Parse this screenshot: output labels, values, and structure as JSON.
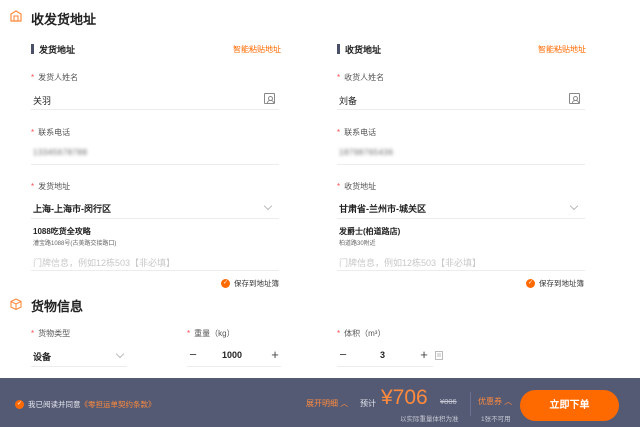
{
  "address_section": {
    "title": "收发货地址",
    "sender": {
      "heading": "发货地址",
      "smart_paste": "智能粘贴地址",
      "name_label": "发货人姓名",
      "name_value": "关羽",
      "phone_label": "联系电话",
      "phone_value": "13345678788",
      "address_label": "发货地址",
      "region_value": "上海-上海市-闵行区",
      "place_name": "1088吃货全攻略",
      "place_detail": "漕宝路1088号(古美路交接路口)",
      "door_placeholder": "门牌信息，例如12栋503【非必填】",
      "save_label": "保存到地址簿"
    },
    "receiver": {
      "heading": "收货地址",
      "smart_paste": "智能粘贴地址",
      "name_label": "收货人姓名",
      "name_value": "刘备",
      "phone_label": "联系电话",
      "phone_value": "18798765436",
      "address_label": "收货地址",
      "region_value": "甘肃省-兰州市-城关区",
      "place_name": "发爵士(柏道路店)",
      "place_detail": "柏道路30附近",
      "door_placeholder": "门牌信息，例如12栋503【非必填】",
      "save_label": "保存到地址簿"
    }
  },
  "cargo_section": {
    "title": "货物信息",
    "type_label": "货物类型",
    "type_value": "设备",
    "weight_label": "重量（kg）",
    "weight_value": "1000",
    "volume_label": "体积（m³）",
    "volume_value": "3"
  },
  "footer": {
    "agree_prefix": "我已阅读并同意",
    "agree_link": "《零担运单契约条款》",
    "expand_details": "展开明细",
    "estimate_label": "预计",
    "price": "¥706",
    "original_price": "¥806",
    "price_note": "以实际重量体积为准",
    "coupon_label": "优惠券",
    "coupon_note": "1张不可用",
    "submit_label": "立即下单"
  },
  "colors": {
    "accent": "#ff6a00",
    "footer_bg": "#545a73",
    "required": "#ff4d4f"
  }
}
